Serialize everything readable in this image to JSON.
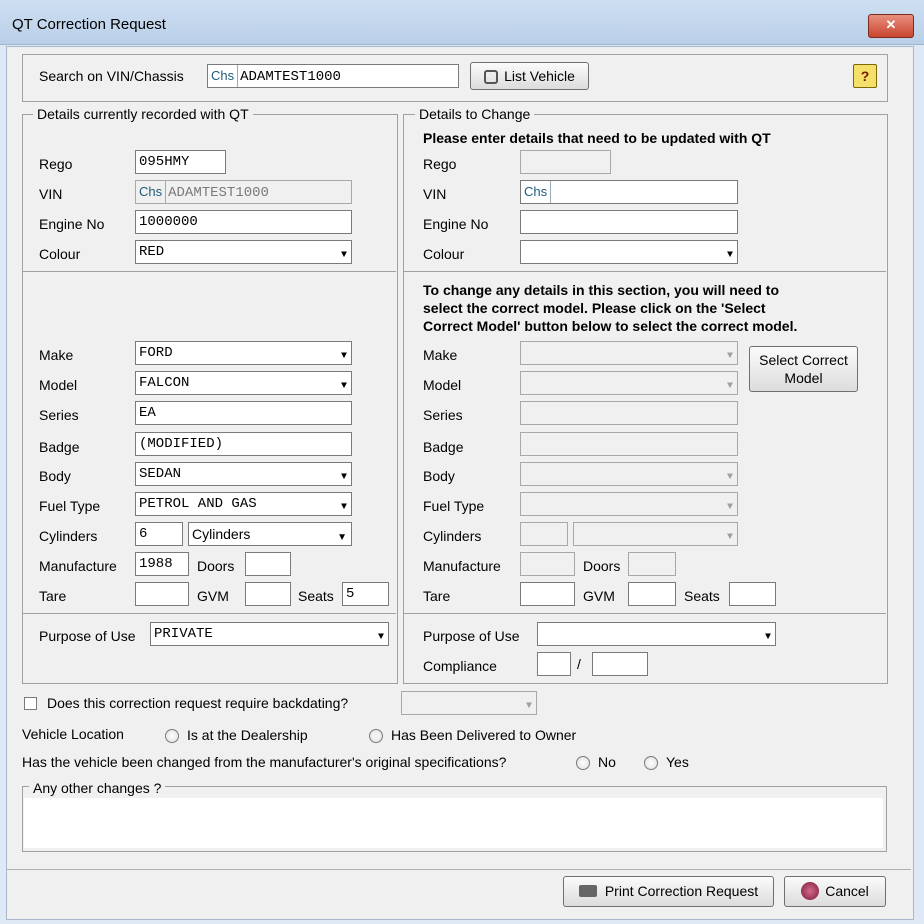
{
  "window": {
    "title": "QT Correction Request",
    "close_label": "✕"
  },
  "search": {
    "label": "Search on VIN/Chassis",
    "prefix": "Chs",
    "value": "ADAMTEST1000",
    "list_button": "List Vehicle",
    "help_icon": "?"
  },
  "current": {
    "legend": "Details currently recorded with QT",
    "rego_label": "Rego",
    "rego": "095HMY",
    "vin_label": "VIN",
    "vin_prefix": "Chs",
    "vin": "ADAMTEST1000",
    "engine_label": "Engine No",
    "engine": "1000000",
    "colour_label": "Colour",
    "colour": "RED",
    "make_label": "Make",
    "make": "FORD",
    "model_label": "Model",
    "model": "FALCON",
    "series_label": "Series",
    "series": "EA",
    "badge_label": "Badge",
    "badge": "(MODIFIED)",
    "body_label": "Body",
    "body": "SEDAN",
    "fuel_label": "Fuel Type",
    "fuel": "PETROL AND GAS",
    "cylinders_label": "Cylinders",
    "cylinders": "6",
    "cylinders_unit": "Cylinders",
    "manufacture_label": "Manufacture",
    "manufacture": "1988",
    "doors_label": "Doors",
    "doors": "",
    "tare_label": "Tare",
    "tare": "",
    "gvm_label": "GVM",
    "gvm": "",
    "seats_label": "Seats",
    "seats": "5",
    "purpose_label": "Purpose of Use",
    "purpose": "PRIVATE"
  },
  "change": {
    "legend": "Details to Change",
    "instruction": "Please enter details that need to be updated with QT",
    "rego_label": "Rego",
    "vin_label": "VIN",
    "vin_prefix": "Chs",
    "engine_label": "Engine No",
    "colour_label": "Colour",
    "model_note_1": "To change any details in this section, you will need to",
    "model_note_2": "select the correct model.  Please click on the 'Select",
    "model_note_3": "Correct Model' button below to select the correct model.",
    "make_label": "Make",
    "model_label": "Model",
    "series_label": "Series",
    "badge_label": "Badge",
    "body_label": "Body",
    "fuel_label": "Fuel Type",
    "cylinders_label": "Cylinders",
    "manufacture_label": "Manufacture",
    "doors_label": "Doors",
    "tare_label": "Tare",
    "gvm_label": "GVM",
    "seats_label": "Seats",
    "select_model_line1": "Select Correct",
    "select_model_line2": "Model",
    "purpose_label": "Purpose of Use",
    "compliance_label": "Compliance",
    "compliance_sep": "/"
  },
  "backdating": {
    "label": "Does this correction request require backdating?"
  },
  "location": {
    "label": "Vehicle Location",
    "opt1": "Is at the Dealership",
    "opt2": "Has Been Delivered to Owner"
  },
  "modified": {
    "label": "Has the vehicle been changed from the manufacturer's original specifications?",
    "no": "No",
    "yes": "Yes"
  },
  "other": {
    "legend": "Any other changes ?"
  },
  "footer": {
    "print_button": "Print Correction Request",
    "cancel_button": "Cancel"
  },
  "colors": {
    "title_bar": "#c4d7ee",
    "close_red": "#c8452f",
    "dialog_bg": "#f0f0f0"
  }
}
